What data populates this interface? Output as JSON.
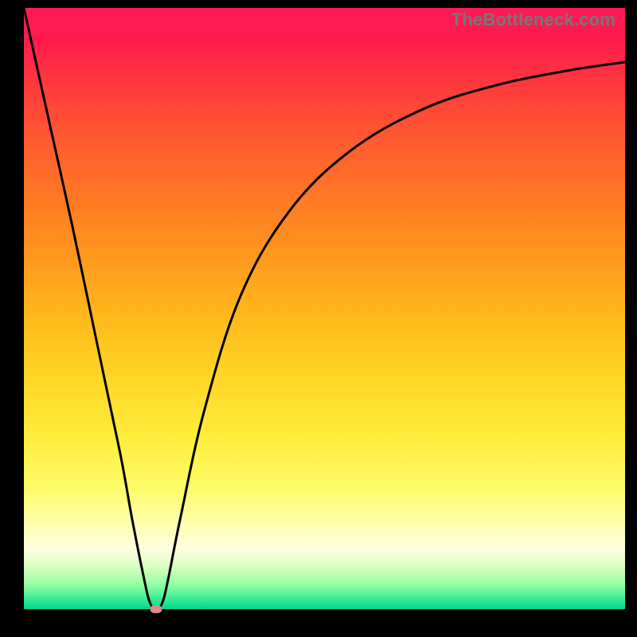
{
  "attribution": "TheBottleneck.com",
  "chart_data": {
    "type": "line",
    "title": "",
    "xlabel": "",
    "ylabel": "",
    "xlim": [
      0,
      100
    ],
    "ylim": [
      0,
      100
    ],
    "x": [
      0,
      4,
      8,
      12,
      16,
      18,
      20,
      21,
      22,
      23,
      24,
      26,
      30,
      36,
      44,
      54,
      66,
      78,
      90,
      100
    ],
    "values": [
      100,
      82,
      64,
      45,
      26,
      15,
      5,
      1,
      0,
      1,
      5,
      15,
      33,
      52,
      66,
      76,
      83,
      87,
      89.5,
      91
    ],
    "minimum_x": 22,
    "gradient_stops": [
      {
        "pos": 0,
        "color": "#ff1a56"
      },
      {
        "pos": 25,
        "color": "#ff6a2b"
      },
      {
        "pos": 50,
        "color": "#ffc020"
      },
      {
        "pos": 75,
        "color": "#fff85a"
      },
      {
        "pos": 92,
        "color": "#e8ffc5"
      },
      {
        "pos": 100,
        "color": "#00d890"
      }
    ],
    "marker": {
      "x": 22,
      "y": 0,
      "color": "#d98b84"
    }
  }
}
